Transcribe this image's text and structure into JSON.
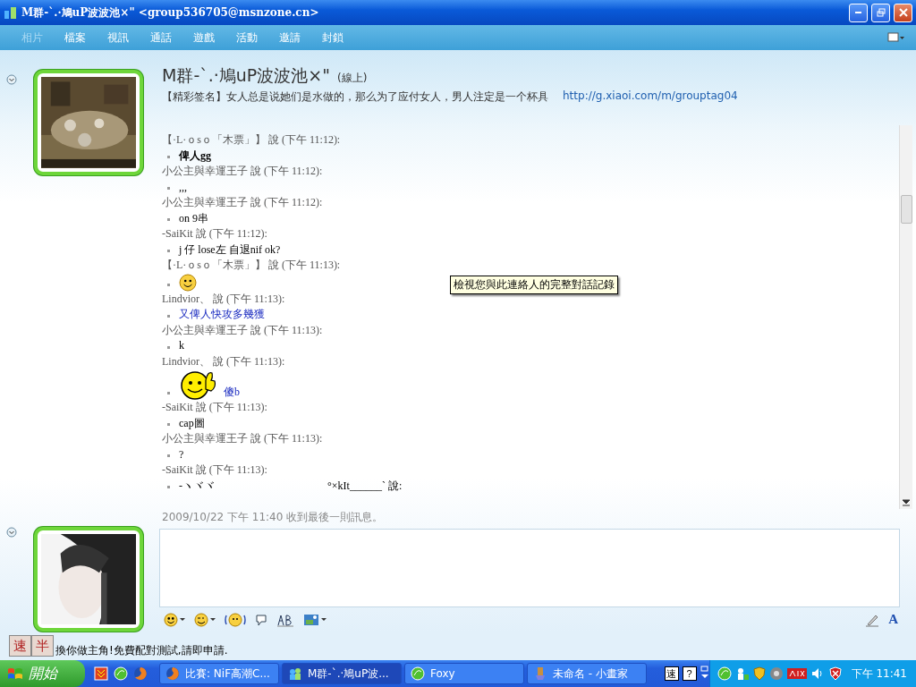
{
  "window": {
    "title": "M群-`.·鳩uP波波池×\" <group536705@msnzone.cn>"
  },
  "menu": [
    {
      "label": "相片",
      "disabled": true
    },
    {
      "label": "檔案",
      "disabled": false
    },
    {
      "label": "視訊",
      "disabled": false
    },
    {
      "label": "通話",
      "disabled": false
    },
    {
      "label": "遊戲",
      "disabled": false
    },
    {
      "label": "活動",
      "disabled": false
    },
    {
      "label": "邀請",
      "disabled": false
    },
    {
      "label": "封鎖",
      "disabled": false
    }
  ],
  "contact": {
    "name": "M群-`.·鳩uP波波池×\"",
    "status": "(線上)",
    "signature": "【精彩签名】女人总是说她们是水做的，那么为了应付女人，男人注定是一个杯具",
    "link": "http://g.xiaoi.com/m/grouptag04"
  },
  "messages": [
    {
      "header": "【·L·ｏsｏ「木票」】 說 (下午 11:12):",
      "body": [
        {
          "kind": "bold_text",
          "text": "俾人gg"
        }
      ]
    },
    {
      "header": "小公主與幸運王子 說 (下午 11:12):",
      "body": [
        {
          "kind": "text",
          "text": ",,,"
        }
      ]
    },
    {
      "header": "小公主與幸運王子 說 (下午 11:12):",
      "body": [
        {
          "kind": "text",
          "text": "on 9串"
        }
      ]
    },
    {
      "header": "-SaiKit 說 (下午 11:12):",
      "body": [
        {
          "kind": "text",
          "text": "j 仔 lose左 自退nif ok?"
        }
      ]
    },
    {
      "header": "【·L·ｏsｏ「木票」】 說 (下午 11:13):",
      "body": [
        {
          "kind": "smiley"
        }
      ]
    },
    {
      "header": "Lindvior、 說 (下午 11:13):",
      "body": [
        {
          "kind": "colored_text",
          "text": "又俾人快攻多幾獲"
        }
      ]
    },
    {
      "header": "小公主與幸運王子 說 (下午 11:13):",
      "body": [
        {
          "kind": "text",
          "text": "k"
        }
      ]
    },
    {
      "header": "Lindvior、 說 (下午 11:13):",
      "body": [
        {
          "kind": "thumbs_up_smiley"
        },
        {
          "kind": "colored_text",
          "text": "傻b"
        }
      ]
    },
    {
      "header": "-SaiKit 說 (下午 11:13):",
      "body": [
        {
          "kind": "text",
          "text": "cap圖"
        }
      ]
    },
    {
      "header": "小公主與幸運王子 說 (下午 11:13):",
      "body": [
        {
          "kind": "text",
          "text": "?"
        }
      ]
    },
    {
      "header": "-SaiKit 說 (下午 11:13):",
      "body": [
        {
          "kind": "text",
          "text": "-ヽヾヾ"
        },
        {
          "kind": "text",
          "text": "°×kIt______` 說:"
        }
      ]
    }
  ],
  "tooltip": "檢視您與此連絡人的完整對話記錄",
  "status_line": "2009/10/22 下午 11:40 收到最後一則訊息。",
  "font_button": "A",
  "ad": {
    "buttons": [
      "速",
      "半"
    ],
    "text": "換你做主角!免費配對測試,請即申請."
  },
  "taskbar": {
    "start": "開始",
    "tasks": [
      {
        "label": "比賽: NiF高潮C...",
        "selected": false,
        "kind": "browser"
      },
      {
        "label": "M群-`.·鳩uP波...",
        "selected": true,
        "kind": "messenger"
      },
      {
        "label": "Foxy",
        "selected": false,
        "kind": "app"
      },
      {
        "label": "未命名 - 小畫家",
        "selected": false,
        "kind": "paint"
      }
    ],
    "tray_key": "速",
    "help_key": "?",
    "clock": "下午 11:41"
  }
}
